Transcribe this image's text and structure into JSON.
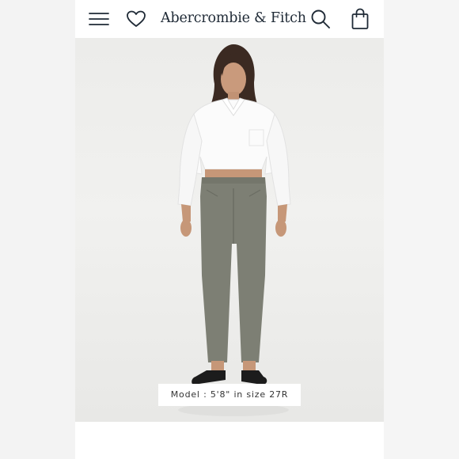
{
  "header": {
    "brand_name": "Abercrombie & Fitch",
    "left_icons": [
      "hamburger-menu-icon",
      "heart-icon"
    ],
    "right_icons": [
      "search-icon",
      "shopping-bag-icon"
    ]
  },
  "product_image": {
    "caption": "Model : 5'8\" in size 27R"
  },
  "colors": {
    "brand_text": "#1f2a36",
    "icon_stroke": "#1f2a36",
    "background": "#ffffff",
    "hero_background": "#ececea"
  }
}
